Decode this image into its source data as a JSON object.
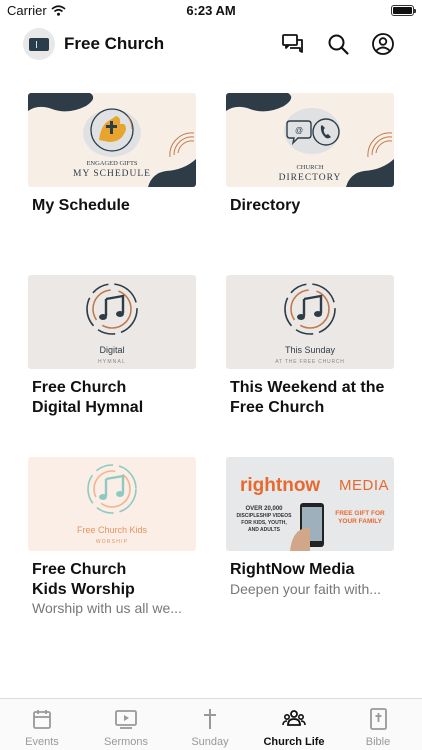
{
  "status": {
    "carrier": "Carrier",
    "time": "6:23 AM"
  },
  "header": {
    "title": "Free Church",
    "logo_text": "FREE CHURCH",
    "icons": [
      "chat-icon",
      "search-icon",
      "account-icon"
    ]
  },
  "cards": [
    {
      "title_lines": [
        "My Schedule"
      ],
      "subtitle": "",
      "thumb_lines": [
        "ENGAGED GIFTS",
        "MY SCHEDULE"
      ]
    },
    {
      "title_lines": [
        "Directory"
      ],
      "subtitle": "",
      "thumb_lines": [
        "CHURCH",
        "DIRECTORY"
      ]
    },
    {
      "title_lines": [
        "Free Church",
        "Digital Hymnal"
      ],
      "subtitle": "",
      "thumb_lines": [
        "Digital",
        "HYMNAL"
      ]
    },
    {
      "title_lines": [
        "This Weekend at the",
        "Free Church"
      ],
      "subtitle": "",
      "thumb_lines": [
        "This Sunday",
        "AT THE FREE CHURCH"
      ]
    },
    {
      "title_lines": [
        "Free Church",
        "Kids Worship"
      ],
      "subtitle": "Worship with us all we...",
      "thumb_lines": [
        "Free Church Kids",
        "WORSHIP"
      ]
    },
    {
      "title_lines": [
        "RightNow Media"
      ],
      "subtitle": "Deepen your faith with...",
      "thumb_lines": [
        "rightnow",
        "MEDIA",
        "OVER 20,000",
        "DISCIPLESHIP VIDEOS",
        "FOR KIDS, YOUTH,",
        "AND ADULTS",
        "FREE GIFT FOR",
        "YOUR FAMILY"
      ]
    }
  ],
  "tabs": [
    {
      "label": "Events",
      "icon": "calendar-icon",
      "active": false
    },
    {
      "label": "Sermons",
      "icon": "video-icon",
      "active": false
    },
    {
      "label": "Sunday",
      "icon": "cross-icon",
      "active": false
    },
    {
      "label": "Church Life",
      "icon": "people-icon",
      "active": true
    },
    {
      "label": "Bible",
      "icon": "bible-icon",
      "active": false
    }
  ],
  "colors": {
    "navy": "#2e3c48",
    "cream": "#f7efe6",
    "rust": "#c07a4f",
    "gray_card": "#ebe8e5",
    "teal": "#8ec9c2",
    "orange": "#e8692e",
    "tab_inactive": "#999999"
  }
}
